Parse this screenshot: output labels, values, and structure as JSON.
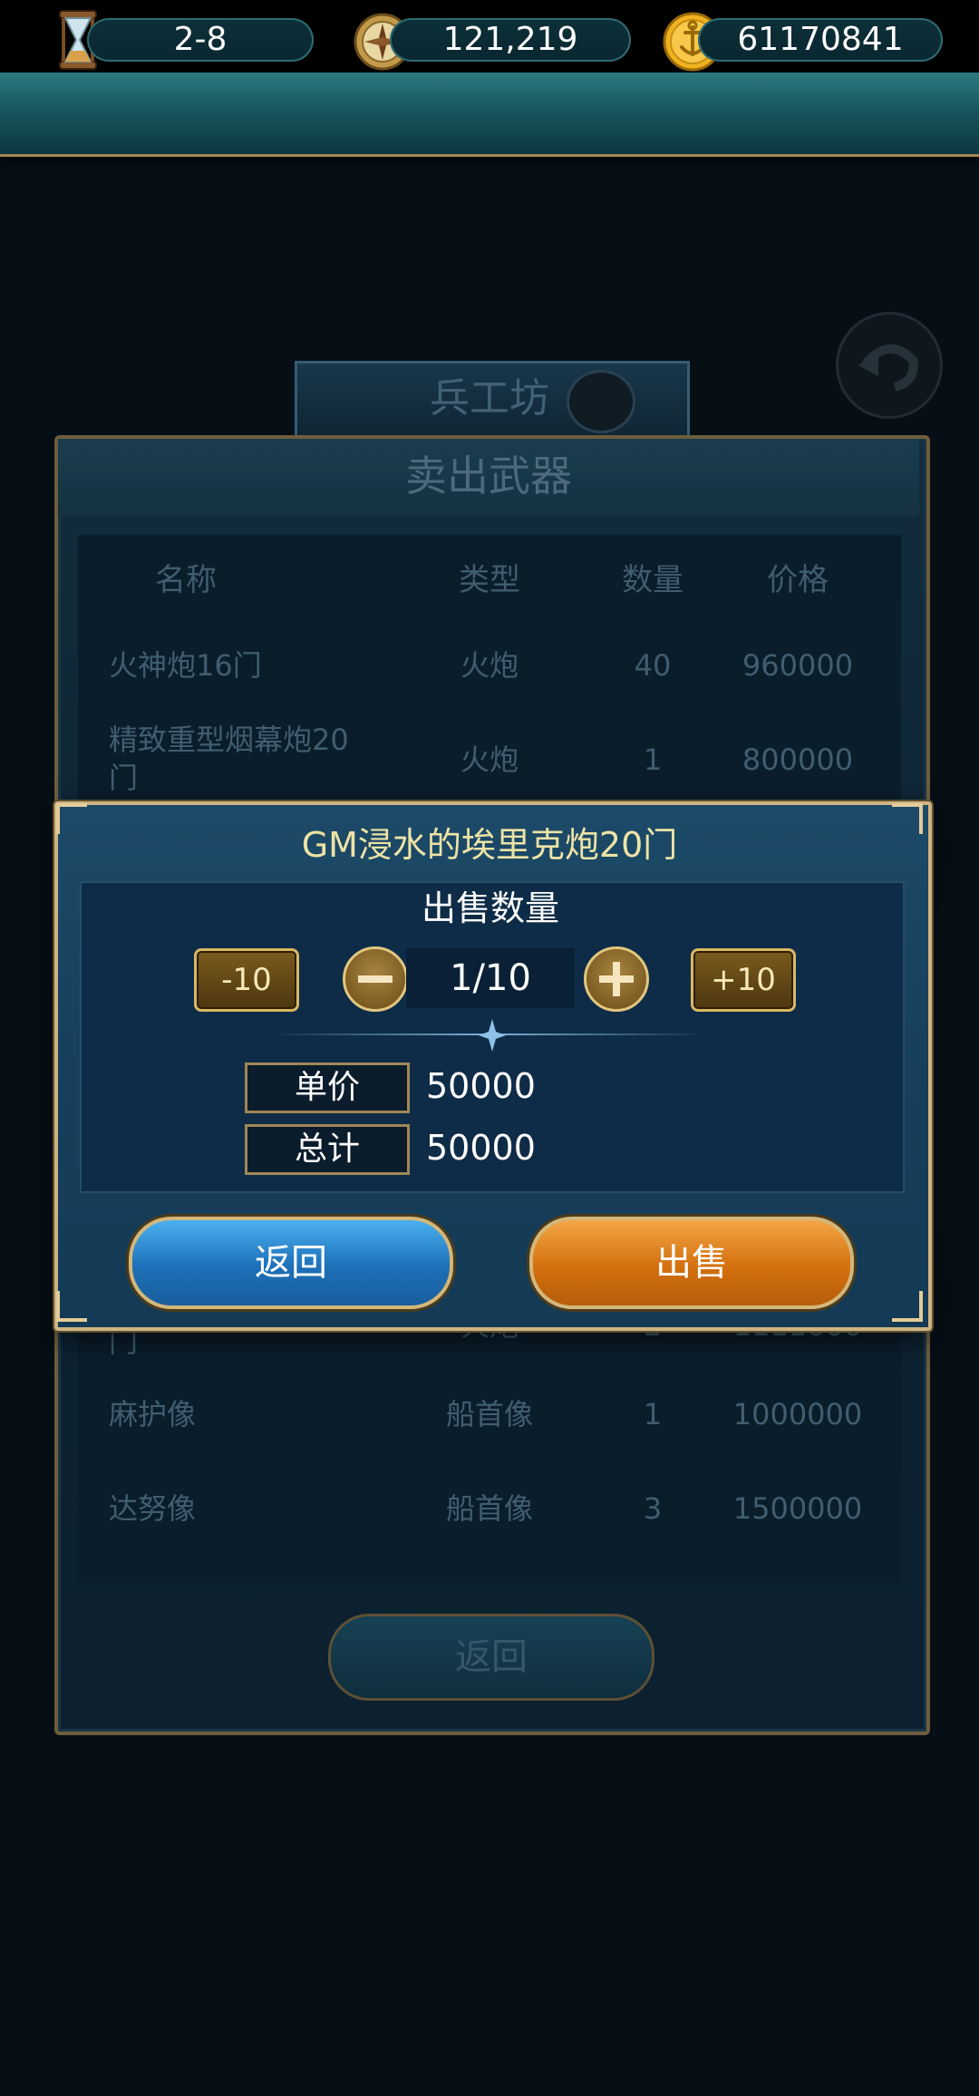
{
  "resources": {
    "stage": "2-8",
    "compass_points": "121,219",
    "gold": "61170841",
    "icons": [
      "hourglass-icon",
      "compass-icon",
      "anchor-coin-icon"
    ]
  },
  "background": {
    "shop_title": "兵工坊",
    "panel_title": "卖出武器",
    "columns": [
      "名称",
      "类型",
      "数量",
      "价格"
    ],
    "rows": [
      {
        "name": "火神炮16门",
        "type": "火炮",
        "qty": "40",
        "price": "960000"
      },
      {
        "name": "精致重型烟幕炮20",
        "name2": "门",
        "type": "火炮",
        "qty": "1",
        "price": "800000"
      },
      {
        "name": "",
        "name2": "门",
        "type": "火炮",
        "qty": "2",
        "price": "1111000"
      },
      {
        "name": "麻护像",
        "type": "船首像",
        "qty": "1",
        "price": "1000000"
      },
      {
        "name": "达努像",
        "type": "船首像",
        "qty": "3",
        "price": "1500000"
      }
    ],
    "back_label": "返回"
  },
  "dialog": {
    "title": "GM浸水的埃里克炮20门",
    "quantity_label": "出售数量",
    "minus10_label": "-10",
    "plus10_label": "+10",
    "quantity_value": "1/10",
    "unit_price_label": "单价",
    "unit_price_value": "50000",
    "total_label": "总计",
    "total_value": "50000",
    "back_label": "返回",
    "sell_label": "出售"
  },
  "colors": {
    "back_button": "#2a8ad6",
    "sell_button": "#e0831e",
    "title_text": "#ece3a6",
    "gold_border": "#cdb482"
  }
}
